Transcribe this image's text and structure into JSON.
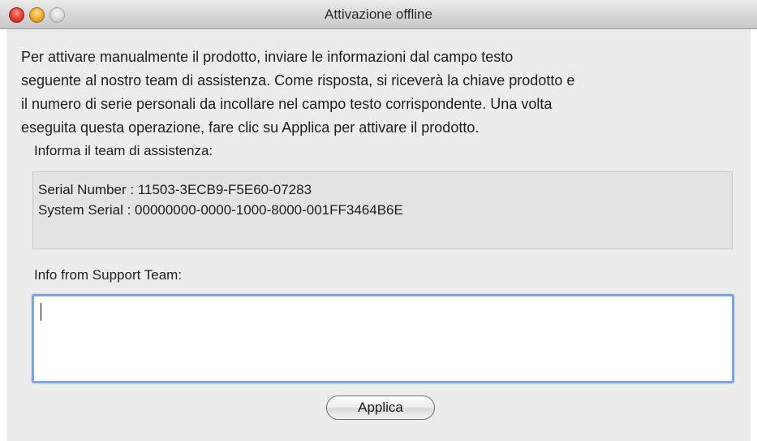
{
  "window": {
    "title": "Attivazione offline",
    "controls": {
      "close": "close-icon",
      "minimize": "minimize-icon",
      "zoom": "zoom-icon"
    }
  },
  "instructions": {
    "lines": [
      "Per attivare manualmente il prodotto, inviare le informazioni dal campo testo",
      "seguente al nostro team di assistenza. Come risposta, si riceverà la chiave prodotto e",
      "il numero di serie personali da incollare nel campo testo corrispondente. Una volta",
      "eseguita questa operazione, fare clic su Applica per attivare il prodotto."
    ]
  },
  "support_info": {
    "label": "Informa il team di assistenza:",
    "serial_number": "Serial Number : 11503-3ECB9-F5E60-07283",
    "system_serial": "System Serial : 00000000-0000-1000-8000-001FF3464B6E"
  },
  "from_support": {
    "label": "Info from Support Team:",
    "value": ""
  },
  "buttons": {
    "apply": "Applica"
  }
}
